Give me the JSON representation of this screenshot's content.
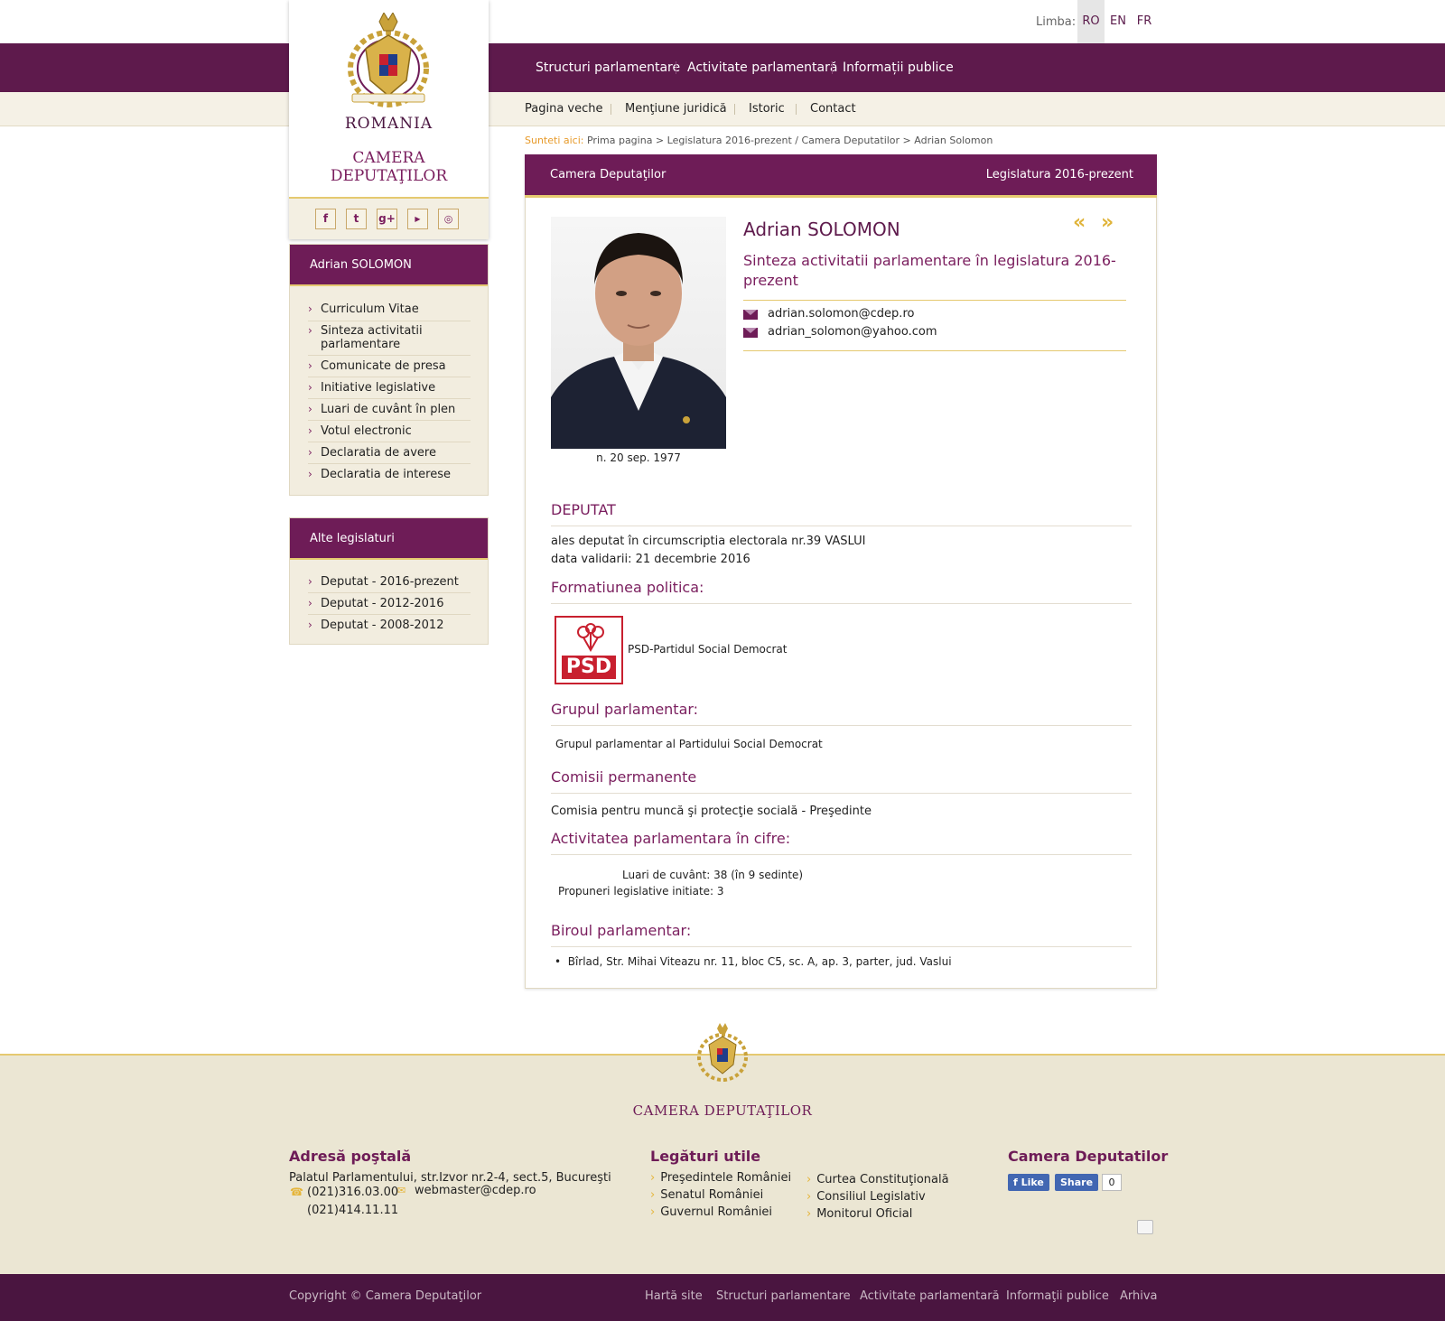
{
  "lang": {
    "label": "Limba:",
    "options": [
      "RO",
      "EN",
      "FR"
    ],
    "active": "RO"
  },
  "main_nav": [
    "Structuri parlamentare",
    "Activitate parlamentară",
    "Informații publice"
  ],
  "sub_nav": [
    "Pagina veche",
    "Menţiune juridică",
    "Istoric",
    "Contact"
  ],
  "logo": {
    "country": "ROMANIA",
    "institution_line1": "CAMERA",
    "institution_line2": "DEPUTAŢILOR"
  },
  "social_icons": [
    "facebook-icon",
    "twitter-icon",
    "google-plus-icon",
    "youtube-icon",
    "instagram-icon"
  ],
  "deputy_menu": {
    "title": "Adrian SOLOMON",
    "items": [
      "Curriculum Vitae",
      "Sinteza activitatii parlamentare",
      "Comunicate de presa",
      "Initiative legislative",
      "Luari de cuvânt în plen",
      "Votul electronic",
      "Declaratia de avere",
      "Declaratia de interese"
    ]
  },
  "other_legislatures": {
    "title": "Alte legislaturi",
    "items": [
      "Deputat - 2016-prezent",
      "Deputat - 2012-2016",
      "Deputat - 2008-2012"
    ]
  },
  "breadcrumb": {
    "here": "Sunteti aici:",
    "path": "Prima pagina > Legislatura 2016-prezent / Camera Deputatilor > Adrian Solomon"
  },
  "panel": {
    "head_left": "Camera Deputaţilor",
    "head_right": "Legislatura 2016-prezent",
    "name": "Adrian SOLOMON",
    "synthesis_link": "Sinteza activitatii parlamentare în legislatura 2016-prezent",
    "emails": [
      "adrian.solomon@cdep.ro",
      "adrian_solomon@yahoo.com"
    ],
    "birth": "n. 20 sep. 1977",
    "deputat_title": "DEPUTAT",
    "elected_text": "ales deputat în circumscriptia electorala nr.39 VASLUI",
    "validation_text": "data validarii: 21 decembrie 2016",
    "party_title": "Formatiunea politica:",
    "party_logo_text": "PSD",
    "party_name": "PSD-Partidul Social Democrat",
    "group_title": "Grupul parlamentar:",
    "group_name": "Grupul parlamentar al Partidului Social Democrat",
    "commissions_title": "Comisii permanente",
    "commission": "Comisia pentru muncă şi protecţie socială",
    "commission_role": "Preşedinte",
    "stats_title": "Activitatea parlamentara în cifre:",
    "stats": [
      "Luari de cuvânt: 38 (în 9 sedinte)",
      "Propuneri legislative initiate: 3"
    ],
    "office_title": "Biroul parlamentar:",
    "office_address": "Bîrlad, Str. Mihai Viteazu nr. 11, bloc C5, sc. A, ap. 3, parter, jud. Vaslui"
  },
  "footer": {
    "logo_title": "CAMERA DEPUTAŢILOR",
    "address_title": "Adresă poştală",
    "address": "Palatul Parlamentului, str.Izvor nr.2-4, sect.5, Bucureşti",
    "phone1": "(021)316.03.00",
    "phone2": "(021)414.11.11",
    "email": "webmaster@cdep.ro",
    "links_title": "Legături utile",
    "links_col1": [
      "Preşedintele României",
      "Senatul României",
      "Guvernul României"
    ],
    "links_col2": [
      "Curtea Constituţională",
      "Consiliul Legislativ",
      "Monitorul Oficial"
    ],
    "social_title": "Camera Deputatilor",
    "fb_like": "Like",
    "fb_share": "Share",
    "fb_count": "0"
  },
  "bottom_bar": {
    "copyright": "Copyright © Camera Deputaţilor",
    "links": [
      "Hartă site",
      "Structuri parlamentare",
      "Activitate parlamentară",
      "Informaţii publice",
      "Arhiva"
    ]
  },
  "colors": {
    "brand_purple": "#5e1a4c",
    "gold": "#e5c970",
    "cream": "#f2eddf",
    "psd_red": "#c8202f"
  }
}
